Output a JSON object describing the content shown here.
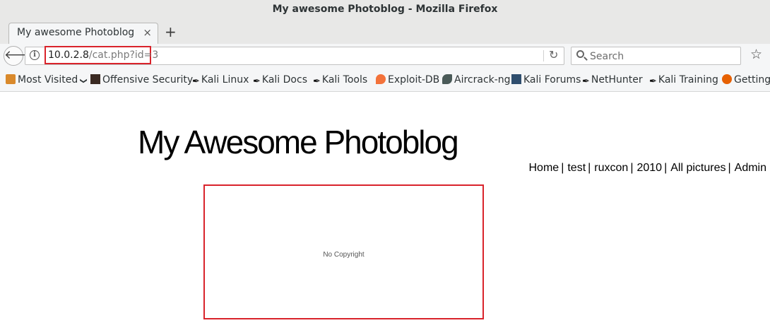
{
  "window": {
    "title": "My awesome Photoblog - Mozilla Firefox"
  },
  "tabs": [
    {
      "title": "My awesome Photoblog",
      "close": "×"
    }
  ],
  "new_tab_label": "+",
  "toolbar": {
    "back_glyph": "🡐",
    "info_glyph": "i",
    "url_host": "10.0.2.8",
    "url_path": "/cat.php?id=3",
    "reload_glyph": "↻",
    "search_placeholder": "Search",
    "search_value": "",
    "star_glyph": "☆"
  },
  "bookmarks": [
    {
      "label": "Most Visited",
      "icon": "folder-icon",
      "chevron": "❯"
    },
    {
      "label": "Offensive Security",
      "icon": "offsec-icon"
    },
    {
      "label": "Kali Linux",
      "icon": "kali-dragon-icon"
    },
    {
      "label": "Kali Docs",
      "icon": "kali-dragon-icon"
    },
    {
      "label": "Kali Tools",
      "icon": "kali-dragon-icon"
    },
    {
      "label": "Exploit-DB",
      "icon": "exploit-db-icon"
    },
    {
      "label": "Aircrack-ng",
      "icon": "aircrack-icon"
    },
    {
      "label": "Kali Forums",
      "icon": "kali-forums-icon"
    },
    {
      "label": "NetHunter",
      "icon": "kali-dragon-icon"
    },
    {
      "label": "Kali Training",
      "icon": "kali-dragon-icon"
    },
    {
      "label": "Getting Started",
      "icon": "firefox-icon"
    }
  ],
  "page": {
    "heading": "My Awesome Photoblog",
    "nav": [
      {
        "label": "Home",
        "sep": "|"
      },
      {
        "label": "test",
        "sep": "|"
      },
      {
        "label": "ruxcon",
        "sep": "|"
      },
      {
        "label": "2010",
        "sep": "|"
      },
      {
        "label": "All pictures",
        "sep": "|"
      },
      {
        "label": "Admin",
        "sep": ""
      }
    ],
    "photo_caption": "No Copyright"
  },
  "colors": {
    "highlight": "#d9232b",
    "chrome": "#f5f6f7",
    "titlebar": "#e8e8e7"
  }
}
